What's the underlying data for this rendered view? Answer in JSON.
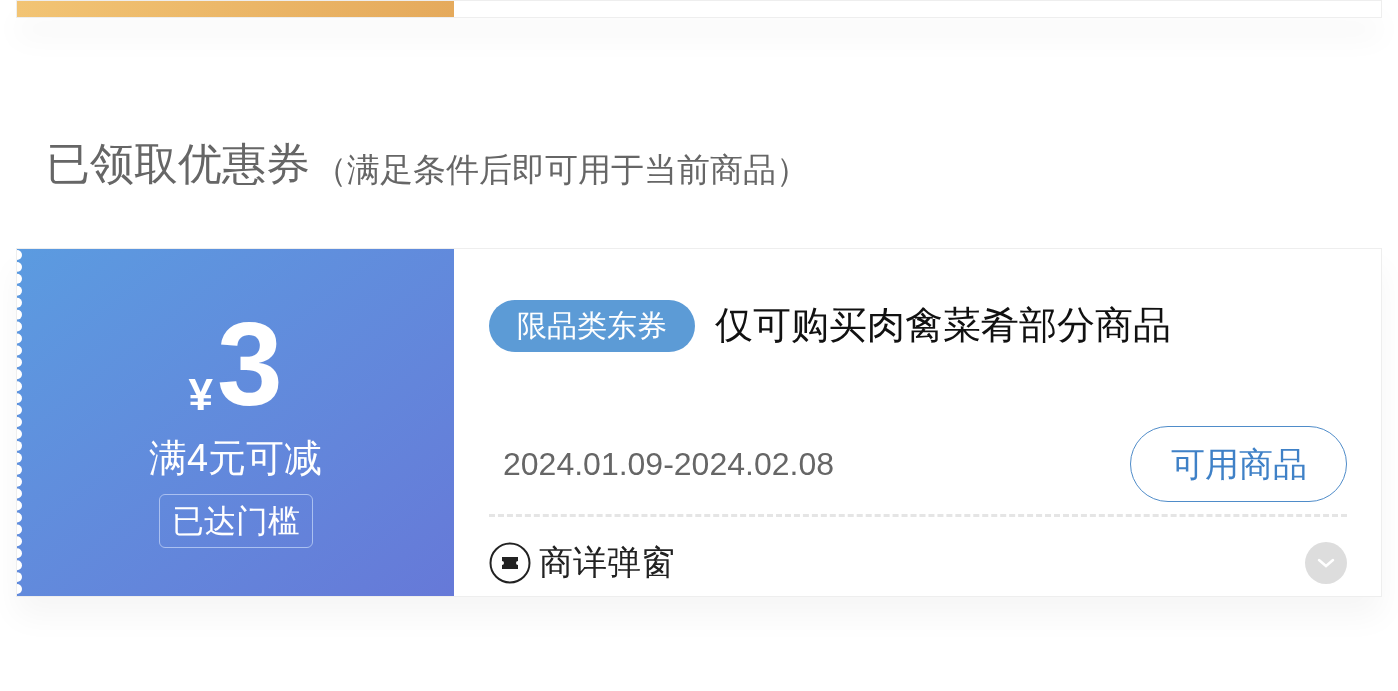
{
  "previous_coupon": {
    "kind": "partial"
  },
  "section": {
    "title": "已领取优惠券",
    "subtitle": "（满足条件后即可用于当前商品）"
  },
  "coupons": [
    {
      "currency": "¥",
      "amount": "3",
      "condition": "满4元可减",
      "threshold_badge": "已达门槛",
      "tag": "限品类东券",
      "title": "仅可购买肉禽菜肴部分商品",
      "validity": "2024.01.09-2024.02.08",
      "button": "可用商品",
      "footer_label": "商详弹窗",
      "expanded": false
    }
  ]
}
